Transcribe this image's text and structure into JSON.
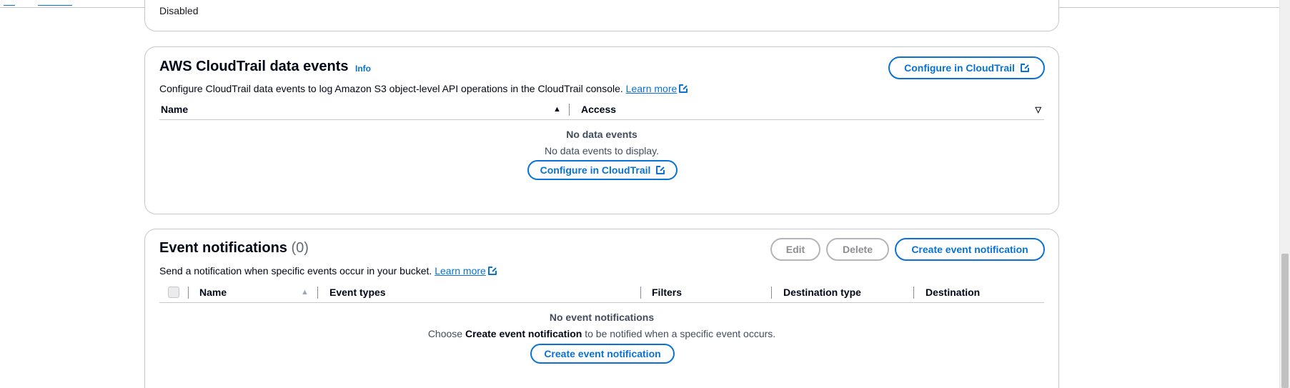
{
  "top_card": {
    "status": "Disabled"
  },
  "cloudtrail": {
    "title": "AWS CloudTrail data events",
    "info": "Info",
    "description": "Configure CloudTrail data events to log Amazon S3 object-level API operations in the CloudTrail console.",
    "learn_more": "Learn more",
    "configure_button": "Configure in CloudTrail",
    "columns": {
      "name": "Name",
      "access": "Access"
    },
    "empty_title": "No data events",
    "empty_sub": "No data events to display.",
    "empty_button": "Configure in CloudTrail",
    "icons": {
      "sort_asc": "sort-ascending-icon",
      "sort_desc": "sort-descending-icon",
      "external": "external-link-icon"
    }
  },
  "event_notifications": {
    "title": "Event notifications",
    "count": "(0)",
    "edit_button": "Edit",
    "delete_button": "Delete",
    "create_button": "Create event notification",
    "description": "Send a notification when specific events occur in your bucket.",
    "learn_more": "Learn more",
    "columns": {
      "name": "Name",
      "event_types": "Event types",
      "filters": "Filters",
      "destination_type": "Destination type",
      "destination": "Destination"
    },
    "empty_title": "No event notifications",
    "empty_sub_prefix": "Choose",
    "empty_sub_bold": "Create event notification",
    "empty_sub_suffix": "to be notified when a specific event occurs.",
    "empty_button": "Create event notification"
  },
  "colors": {
    "accent": "#0972d3",
    "border": "#c6c6cd",
    "disabled": "#8d8d94"
  }
}
